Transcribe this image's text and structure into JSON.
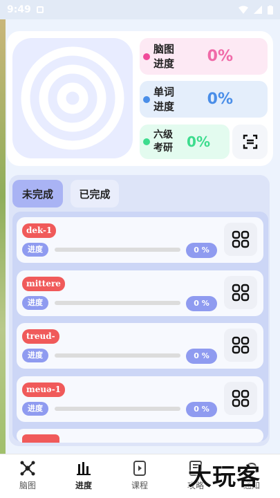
{
  "status_bar": {
    "time": "9:49"
  },
  "stats": {
    "mindmap": {
      "label": "脑图进度",
      "value": "0%",
      "color": "#f06aa8",
      "dot": "#f04a9a"
    },
    "words": {
      "label": "单词进度",
      "value": "0%",
      "color": "#4a8ee8",
      "dot": "#4a8ee8"
    },
    "cet6": {
      "label": "六级考研",
      "value": "0%",
      "color": "#3ddc8e",
      "dot": "#3ddc8e"
    }
  },
  "tabs": [
    {
      "label": "未完成",
      "active": true
    },
    {
      "label": "已完成",
      "active": false
    }
  ],
  "items": [
    {
      "tag": "dek-1",
      "progress_label": "进度",
      "percent": "0 %",
      "progress": 0
    },
    {
      "tag": "mittere",
      "progress_label": "进度",
      "percent": "0 %",
      "progress": 0
    },
    {
      "tag": "treud-",
      "progress_label": "进度",
      "percent": "0 %",
      "progress": 0
    },
    {
      "tag": "meuə-1",
      "progress_label": "进度",
      "percent": "0 %",
      "progress": 0
    }
  ],
  "nav": [
    {
      "label": "脑图",
      "icon": "mindmap-icon"
    },
    {
      "label": "进度",
      "icon": "chart-icon",
      "active": true
    },
    {
      "label": "课程",
      "icon": "play-icon"
    },
    {
      "label": "攻略",
      "icon": "book-icon"
    },
    {
      "label": "通知",
      "icon": "bell-icon"
    }
  ],
  "watermark": "大玩客"
}
